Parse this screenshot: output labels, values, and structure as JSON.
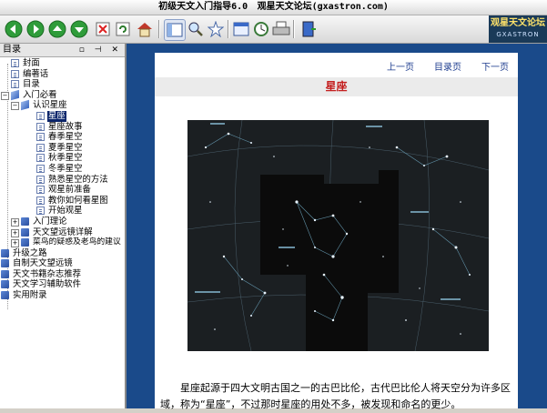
{
  "title": {
    "app": "初级天文入门指导6.0",
    "site": "观星天文论坛",
    "url": "(gxastron.com)"
  },
  "toolbar": {
    "icons": [
      "back-icon",
      "forward-icon",
      "up-icon",
      "down-icon",
      "stop-icon",
      "refresh-icon",
      "home-icon",
      "toggle-panel-icon",
      "search-icon",
      "favorites-icon",
      "options-icon",
      "history-icon",
      "print-icon",
      "exit-icon"
    ]
  },
  "logo": {
    "text": "观星天文论坛",
    "sub": "GXASTRON"
  },
  "sidebar": {
    "header": "目录",
    "nodes": [
      {
        "label": "封面"
      },
      {
        "label": "编著话"
      },
      {
        "label": "目录"
      },
      {
        "label": "入门必看"
      },
      {
        "label": "认识星座"
      },
      {
        "label": "星座"
      },
      {
        "label": "星座故事"
      },
      {
        "label": "春季星空"
      },
      {
        "label": "夏季星空"
      },
      {
        "label": "秋季星空"
      },
      {
        "label": "冬季星空"
      },
      {
        "label": "熟悉星空的方法"
      },
      {
        "label": "观星前准备"
      },
      {
        "label": "教你如何看星图"
      },
      {
        "label": "开始观星"
      },
      {
        "label": "入门理论"
      },
      {
        "label": "天文望远镜详解"
      },
      {
        "label": "菜鸟的疑惑及老鸟的建议"
      },
      {
        "label": "升级之路"
      },
      {
        "label": "自制天文望远镜"
      },
      {
        "label": "天文书籍杂志推荐"
      },
      {
        "label": "天文学习辅助软件"
      },
      {
        "label": "实用附录"
      }
    ]
  },
  "content": {
    "nav": {
      "prev": "上一页",
      "toc": "目录页",
      "next": "下一页"
    },
    "heading": "星座",
    "paragraph": "星座起源于四大文明古国之一的古巴比伦，古代巴比伦人将天空分为许多区域，称为“星座”，不过那时星座的用处不多，被发现和命名的更少。"
  }
}
